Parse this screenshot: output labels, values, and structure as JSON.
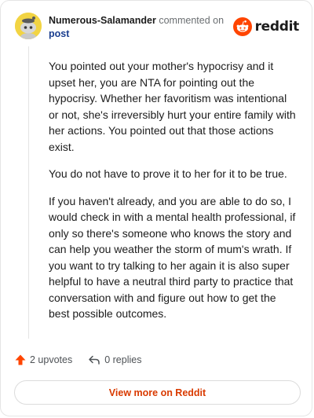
{
  "header": {
    "username": "Numerous-Salamander",
    "action": "commented on",
    "post_link": "post",
    "brand": "reddit"
  },
  "comment": {
    "paragraphs": [
      "You pointed out your mother's hypocrisy and it upset her, you are NTA for pointing out the hypocrisy. Whether her favoritism was intentional or not, she's irreversibly hurt your entire family with her actions. You pointed out that those actions exist.",
      "You do not have to prove it to her for it to be true.",
      "If you haven't already, and you are able to do so, I would check in with a mental health professional, if only so there's someone who knows the story and can help you weather the storm of mum's wrath. If you want to try talking to her again it is also super helpful to have a neutral third party to practice that conversation with and figure out how to get the best possible outcomes."
    ]
  },
  "footer": {
    "upvotes": "2 upvotes",
    "replies": "0 replies",
    "view_more": "View more on Reddit"
  },
  "colors": {
    "brand_orange": "#ff4500",
    "link_blue": "#1a3e8f",
    "view_more_text": "#d93a00",
    "avatar_bg": "#f2d443"
  },
  "icons": {
    "upvote": "upvote-arrow-icon",
    "reply": "reply-arrow-icon",
    "logo": "reddit-snoo-icon"
  }
}
